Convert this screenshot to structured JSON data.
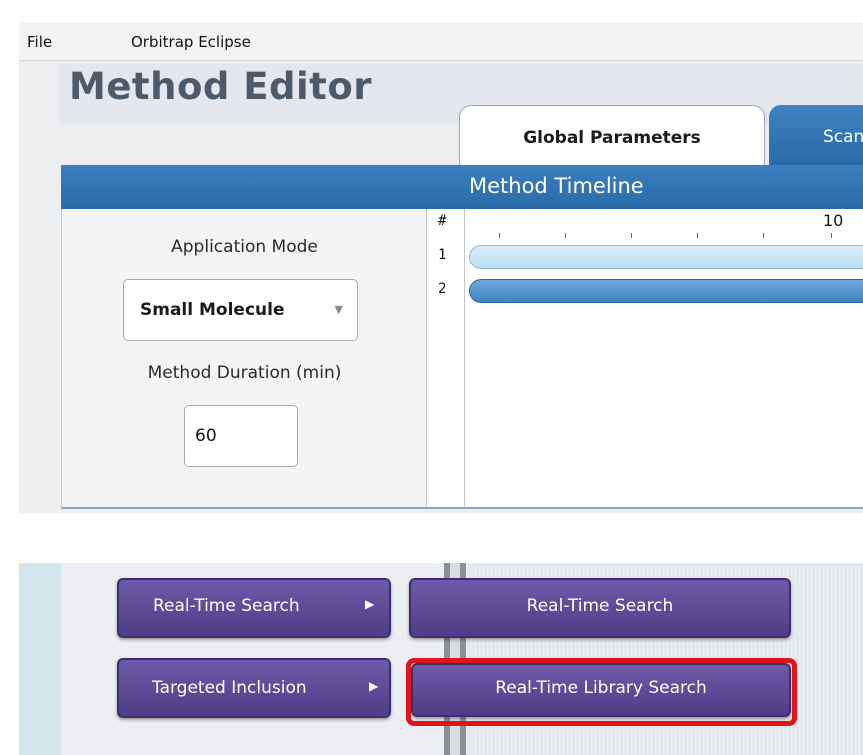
{
  "menubar": {
    "items": [
      "File",
      "Orbitrap Eclipse"
    ]
  },
  "editor": {
    "title": "Method Editor",
    "tabs": [
      {
        "label": "Global Parameters",
        "selected": true
      },
      {
        "label": "Scan",
        "selected": false
      }
    ],
    "timeline_header": "Method Timeline"
  },
  "settings": {
    "application_mode_label": "Application Mode",
    "application_mode_value": "Small Molecule",
    "duration_label": "Method Duration (min)",
    "duration_value": "60"
  },
  "timeline": {
    "row_header": "#",
    "rows": [
      "1",
      "2"
    ],
    "axis_tick_label": "10"
  },
  "context_menu": {
    "items": [
      {
        "label": "Real-Time Search",
        "has_submenu": true
      },
      {
        "label": "Targeted Inclusion",
        "has_submenu": true
      }
    ],
    "submenu": [
      {
        "label": "Real-Time Search",
        "highlighted": false
      },
      {
        "label": "Real-Time Library Search",
        "highlighted": true
      }
    ]
  },
  "colors": {
    "header_blue": "#2f71b0",
    "button_purple": "#5b4896",
    "highlight_red": "#e0141f"
  },
  "icons": {
    "dropdown": "chevron-down-icon",
    "submenu": "triangle-right-icon"
  }
}
